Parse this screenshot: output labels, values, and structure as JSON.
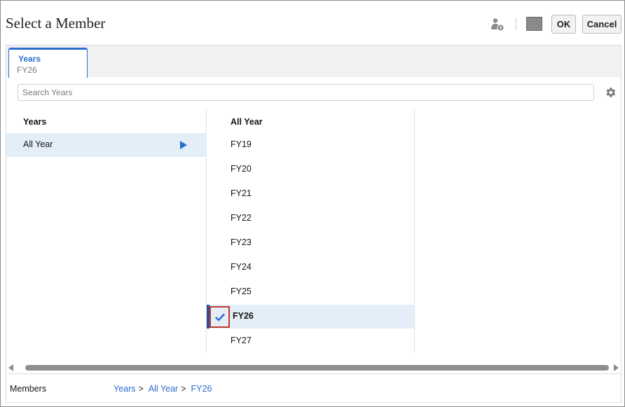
{
  "dialog": {
    "title": "Select a Member",
    "ok_label": "OK",
    "cancel_label": "Cancel"
  },
  "tab": {
    "title": "Years",
    "value": "FY26"
  },
  "search": {
    "placeholder": "Search Years"
  },
  "column1": {
    "header": "Years",
    "items": [
      {
        "label": "All Year",
        "selected": true,
        "has_children": true
      }
    ]
  },
  "column2": {
    "header": "All Year",
    "items": [
      {
        "label": "FY19",
        "checked": false
      },
      {
        "label": "FY20",
        "checked": false
      },
      {
        "label": "FY21",
        "checked": false
      },
      {
        "label": "FY22",
        "checked": false
      },
      {
        "label": "FY23",
        "checked": false
      },
      {
        "label": "FY24",
        "checked": false
      },
      {
        "label": "FY25",
        "checked": false
      },
      {
        "label": "FY26",
        "checked": true
      },
      {
        "label": "FY27",
        "checked": false
      }
    ]
  },
  "footer": {
    "label": "Members",
    "breadcrumb": [
      "Years",
      "All Year",
      "FY26"
    ],
    "separator": ">"
  },
  "colors": {
    "accent": "#2a6dcf",
    "selection_bg": "#e4eef8",
    "highlight_border": "#c0392b"
  },
  "icons": {
    "user": "user-help-icon",
    "settings": "gear-icon",
    "check": "check-icon",
    "expand": "play-arrow-icon"
  }
}
